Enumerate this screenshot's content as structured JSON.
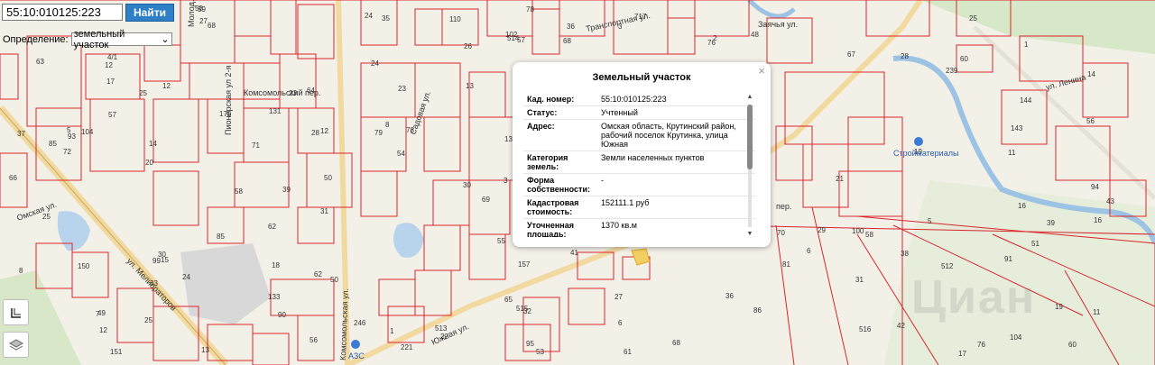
{
  "search": {
    "value": "55:10:010125:223",
    "button_label": "Найти"
  },
  "definition": {
    "label": "Определение:",
    "selected": "земельный участок"
  },
  "popup": {
    "title": "Земельный участок",
    "close": "×",
    "rows": [
      {
        "label": "Кад. номер:",
        "value": "55:10:010125:223"
      },
      {
        "label": "Статус:",
        "value": "Учтенный"
      },
      {
        "label": "Адрес:",
        "value": "Омская область, Крутинский район, рабочий поселок Крутинка, улица Южная"
      },
      {
        "label": "Категория земель:",
        "value": "Земли населенных пунктов"
      },
      {
        "label": "Форма собственности:",
        "value": "-"
      },
      {
        "label": "Кадастровая стоимость:",
        "value": "152111.1 руб"
      },
      {
        "label": "Уточненная площадь:",
        "value": "1370 кв.м"
      }
    ]
  },
  "streets": {
    "molodezhnaya": "Молод...",
    "transportnaya": "Транспортная ул.",
    "komsomolsky_per": "Комсомольский пер.",
    "pionerskaya": "Пионерская ул 2-я",
    "sadovaya": "Садовая ул.",
    "omskaya": "Омская ул.",
    "melioratorov": "ул. Мелиораторов",
    "yuzhnaya": "Южная ул.",
    "komsomolskaya": "Комсомольская ул.",
    "lenina": "ул. Ленина",
    "zayachya": "Заячья ул.",
    "per": "пер."
  },
  "poi": {
    "stroymaterialy": "Стройматериалы",
    "azs": "АЗС"
  },
  "watermark": "Циан",
  "lot_labels": [
    "25",
    "49",
    "50",
    "48",
    "68",
    "60",
    "20",
    "14",
    "69",
    "13",
    "24",
    "78",
    "12",
    "90",
    "58",
    "12",
    "57",
    "72",
    "70",
    "56",
    "3",
    "65",
    "64",
    "67",
    "62",
    "76",
    "19",
    "100",
    "717",
    "79",
    "71",
    "81",
    "56",
    "37",
    "151",
    "32",
    "33",
    "144",
    "63",
    "6",
    "86",
    "133",
    "27",
    "27",
    "60",
    "36",
    "50",
    "104",
    "131",
    "28",
    "58",
    "2",
    "26",
    "8",
    "157",
    "1",
    "29",
    "28",
    "7",
    "175",
    "25",
    "13",
    "6",
    "25",
    "51",
    "95",
    "11",
    "41",
    "42",
    "61",
    "36",
    "102",
    "43",
    "31",
    "91",
    "93",
    "53",
    "58",
    "24",
    "94",
    "85",
    "85",
    "18",
    "246",
    "239",
    "54",
    "16",
    "12",
    "30",
    "35",
    "150",
    "1",
    "13",
    "110",
    "99",
    "25",
    "23",
    "21",
    "62",
    "104",
    "22",
    "19",
    "17",
    "15",
    "68",
    "12",
    "24",
    "39",
    "38",
    "31",
    "30",
    "16",
    "8",
    "14",
    "512",
    "4/1",
    "513",
    "516",
    "515",
    "514",
    "143",
    "23",
    "5",
    "221",
    "5",
    "3",
    "39",
    "68",
    "66",
    "78",
    "76",
    "57",
    "55",
    "11",
    "59",
    "17"
  ]
}
